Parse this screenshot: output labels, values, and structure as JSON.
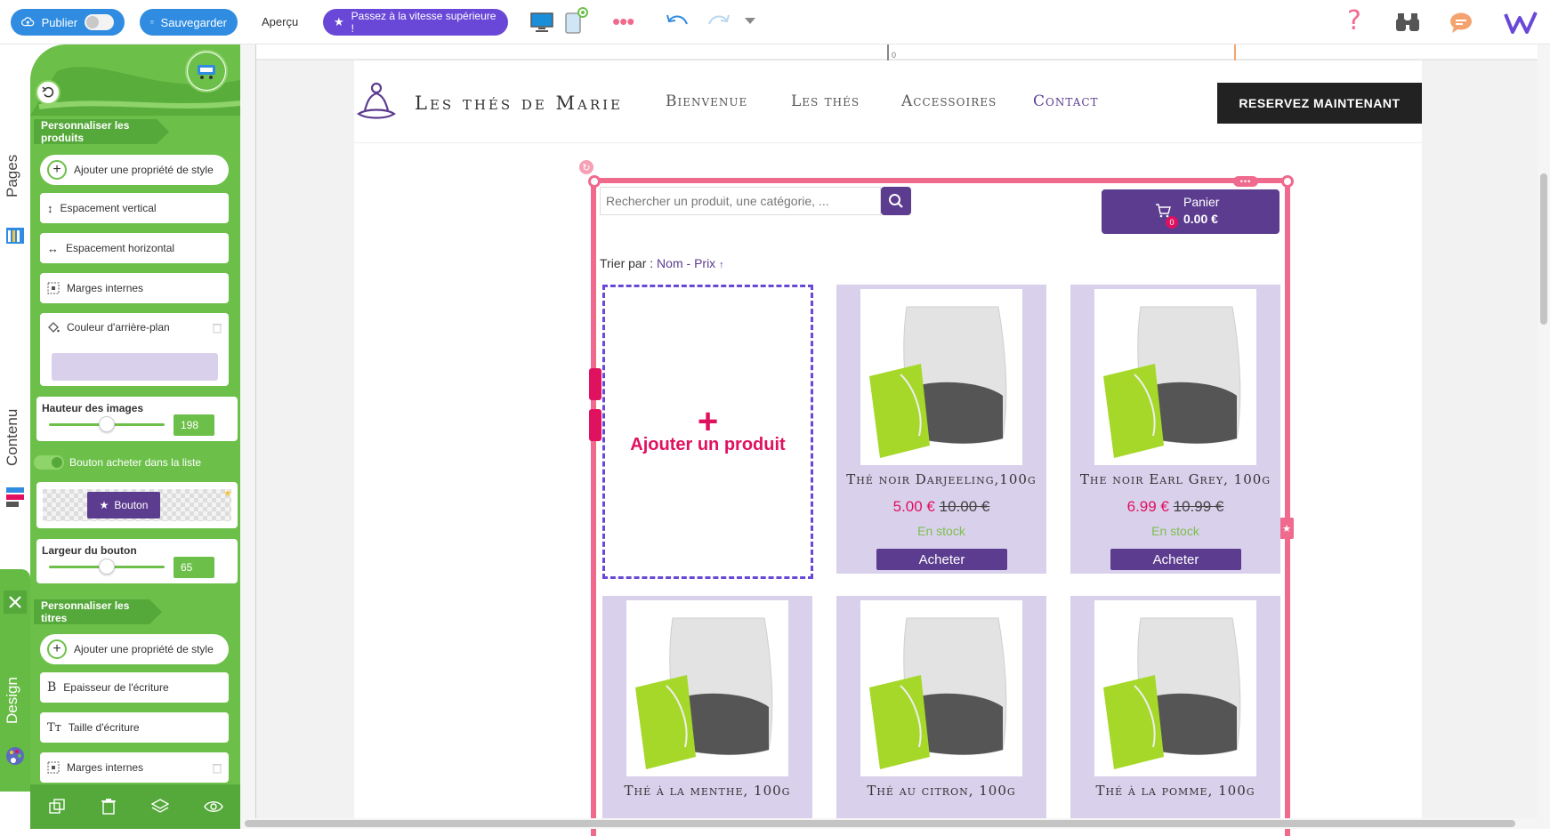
{
  "toolbar": {
    "publish_label": "Publier",
    "save_label": "Sauvegarder",
    "preview_label": "Aperçu",
    "upgrade_label": "Passez à la vitesse supérieure !"
  },
  "side_tabs": {
    "pages": "Pages",
    "content": "Contenu",
    "design": "Design"
  },
  "panel": {
    "products_section": "Personnaliser les produits",
    "add_style_prop": "Ajouter une propriété de style",
    "vertical_spacing": "Espacement vertical",
    "horizontal_spacing": "Espacement horizontal",
    "inner_margins": "Marges internes",
    "bg_color": "Couleur d'arrière-plan",
    "bg_color_value": "#d9d0ec",
    "image_height_label": "Hauteur des images",
    "image_height_value": "198",
    "buy_button_toggle": "Bouton acheter dans la liste",
    "button_preview": "Bouton",
    "button_width_label": "Largeur du bouton",
    "button_width_value": "65",
    "titles_section": "Personnaliser les titres",
    "add_style_prop_2": "Ajouter une propriété de style",
    "font_weight": "Epaisseur de l'écriture",
    "font_size": "Taille d'écriture",
    "inner_margins_2": "Marges internes"
  },
  "ruler": {
    "zero": "0"
  },
  "site": {
    "brand": "Les thés de Marie",
    "nav": [
      "Bienvenue",
      "Les thés",
      "Accessoires",
      "Contact"
    ],
    "cta": "RESERVEZ MAINTENANT"
  },
  "shop": {
    "search_placeholder": "Rechercher un produit, une catégorie, ...",
    "cart_label": "Panier",
    "cart_total": "0.00 €",
    "cart_count": "0",
    "sort_label": "Trier par :",
    "sort_name": "Nom",
    "sort_sep": "-",
    "sort_price": "Prix",
    "sort_arrow": "↑",
    "add_product": "Ajouter un produit",
    "products": [
      {
        "title": "Thé noir Darjeeling,100g",
        "price": "5.00 €",
        "old_price": "10.00 €",
        "stock": "En stock",
        "buy": "Acheter"
      },
      {
        "title": "The noir Earl Grey, 100g",
        "price": "6.99 €",
        "old_price": "10.99 €",
        "stock": "En stock",
        "buy": "Acheter"
      },
      {
        "title": "Thé à la menthe, 100g"
      },
      {
        "title": "Thé au citron, 100g"
      },
      {
        "title": "Thé à la pomme, 100g"
      }
    ]
  },
  "colors": {
    "panel_green": "#6cc04a",
    "accent_purple": "#5b3c8f",
    "selection_pink": "#f06a8e",
    "price_red": "#e0115f"
  }
}
